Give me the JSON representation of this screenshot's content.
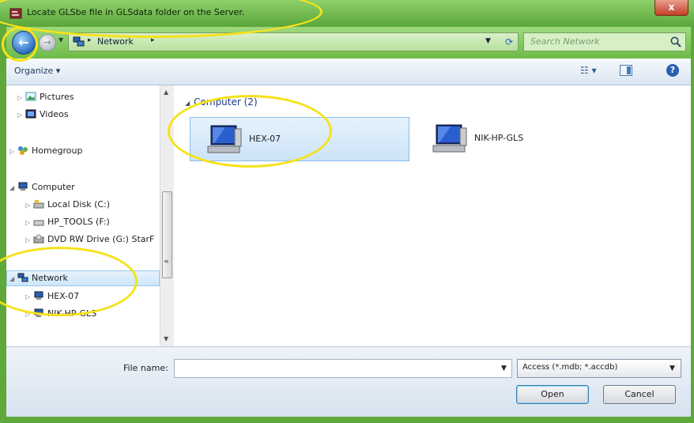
{
  "window": {
    "title": "Locate GLSbe file in GLSdata folder on the Server.",
    "close_label": "x",
    "accent_color": "#5fa83a"
  },
  "navbar": {
    "back_icon": "back-arrow-icon",
    "back_glyph": "←",
    "forward_glyph": "→",
    "address_text": "Network",
    "search_placeholder": "Search Network"
  },
  "toolbar": {
    "organize_label": "Organize ▾",
    "view_glyph": "☷ ▾",
    "help_glyph": "?"
  },
  "nav_pane": {
    "items": [
      {
        "label": "Pictures",
        "icon": "pictures-icon"
      },
      {
        "label": "Videos",
        "icon": "videos-icon"
      },
      {
        "label": "Homegroup",
        "icon": "homegroup-icon"
      },
      {
        "label": "Computer",
        "icon": "computer-icon"
      },
      {
        "label": "Local Disk (C:)",
        "icon": "drive-icon"
      },
      {
        "label": "HP_TOOLS (F:)",
        "icon": "drive-icon"
      },
      {
        "label": "DVD RW Drive (G:) StarF",
        "icon": "dvd-drive-icon"
      },
      {
        "label": "Network",
        "icon": "network-icon"
      },
      {
        "label": "HEX-07",
        "icon": "computer-icon"
      },
      {
        "label": "NIK-HP-GLS",
        "icon": "computer-icon"
      }
    ],
    "selected": "Network"
  },
  "content": {
    "group_header": "Computer (2)",
    "items": [
      {
        "label": "HEX-07",
        "selected": true,
        "icon": "computer-icon"
      },
      {
        "label": "NIK-HP-GLS",
        "selected": false,
        "icon": "computer-icon"
      }
    ]
  },
  "bottom": {
    "filename_label": "File name:",
    "filename_value": "",
    "filter_value": "Access (*.mdb; *.accdb)",
    "open_label": "Open",
    "cancel_label": "Cancel"
  },
  "highlight_color": "#f5e21a"
}
